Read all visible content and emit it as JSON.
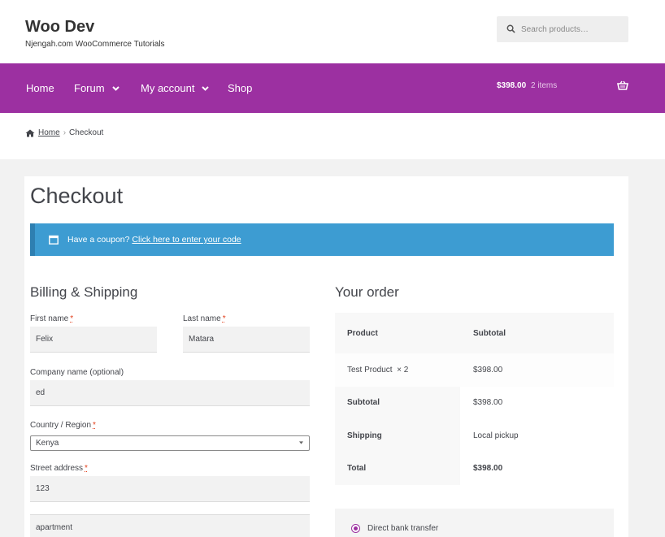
{
  "site": {
    "title": "Woo Dev",
    "tagline": "Njengah.com WooCommerce Tutorials"
  },
  "search": {
    "placeholder": "Search products…",
    "icon": "search-icon"
  },
  "nav": {
    "items": [
      {
        "label": "Home",
        "has_dropdown": false
      },
      {
        "label": "Forum",
        "has_dropdown": true
      },
      {
        "label": "My account",
        "has_dropdown": true
      },
      {
        "label": "Shop",
        "has_dropdown": false
      }
    ],
    "cart": {
      "amount": "$398.00",
      "count": "2 items",
      "icon": "basket-icon"
    },
    "color": "#9c30a1"
  },
  "breadcrumb": {
    "home": "Home",
    "current": "Checkout"
  },
  "page_title": "Checkout",
  "coupon": {
    "text": "Have a coupon?",
    "link": "Click here to enter your code",
    "color": "#3d9cd2"
  },
  "billing": {
    "title": "Billing & Shipping",
    "first_name": {
      "label": "First name",
      "required": "*",
      "value": "Felix"
    },
    "last_name": {
      "label": "Last name",
      "required": "*",
      "value": "Matara"
    },
    "company": {
      "label": "Company name (optional)",
      "value": "ed"
    },
    "country": {
      "label": "Country / Region",
      "required": "*",
      "value": "Kenya"
    },
    "street": {
      "label": "Street address",
      "required": "*",
      "value": "123",
      "value2": "apartment"
    }
  },
  "order": {
    "title": "Your order",
    "header": {
      "product": "Product",
      "subtotal": "Subtotal"
    },
    "item": {
      "name": "Test Product",
      "qty": "× 2",
      "total": "$398.00"
    },
    "rows": [
      {
        "label": "Subtotal",
        "value": "$398.00"
      },
      {
        "label": "Shipping",
        "value": "Local pickup"
      },
      {
        "label": "Total",
        "value": "$398.00"
      }
    ]
  },
  "payment": {
    "method": "Direct bank transfer"
  }
}
